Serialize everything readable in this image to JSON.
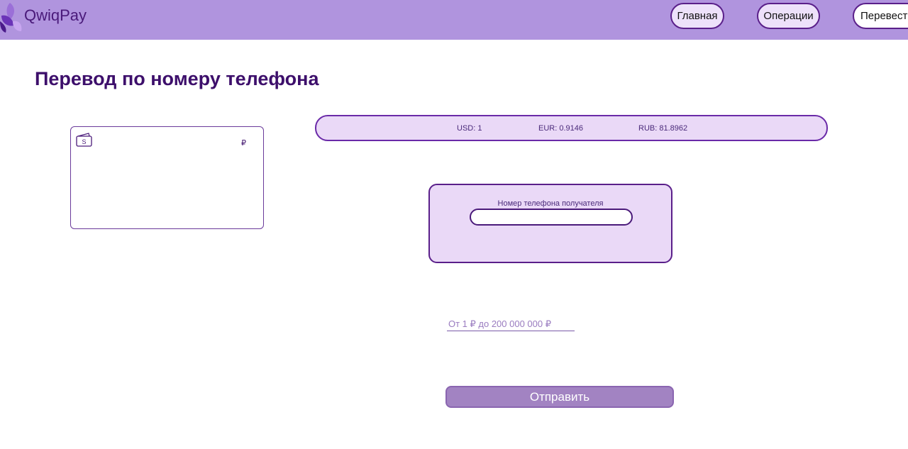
{
  "header": {
    "brand": "QwiqPay",
    "nav": {
      "home": "Главная",
      "operations": "Операции",
      "transfer": "Перевести"
    }
  },
  "page": {
    "title": "Перевод по номеру телефона"
  },
  "card": {
    "balance_currency": "₽",
    "wallet_icon_letter": "S"
  },
  "rates": {
    "usd": "USD: 1",
    "eur": "EUR: 0.9146",
    "rub": "RUB: 81.8962"
  },
  "transfer_form": {
    "phone_label": "Номер телефона получателя",
    "phone_value": "",
    "amount_placeholder": "От 1 ₽ до 200 000 000 ₽",
    "amount_value": "",
    "submit_label": "Отправить"
  },
  "colors": {
    "header_bg": "#b094de",
    "brand_text": "#4a1a7a",
    "panel_bg": "#ead9f7",
    "accent_border": "#5a1f8a",
    "button_bg": "#a283c2"
  },
  "icons": {
    "logo": "purple-flower-logo-icon",
    "wallet": "wallet-icon"
  }
}
